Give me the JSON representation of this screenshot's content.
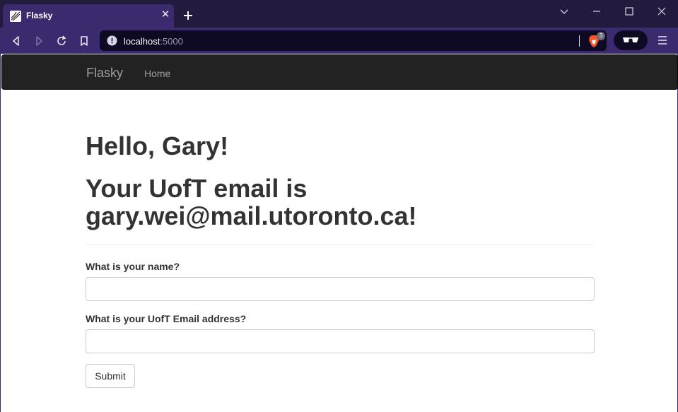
{
  "browser": {
    "tab_title": "Flasky",
    "url_host": "localhost",
    "url_port": ":5000",
    "shields_count": "3"
  },
  "navbar": {
    "brand": "Flasky",
    "home_link": "Home",
    "bg_color": "#222222"
  },
  "main": {
    "greeting": "Hello, Gary!",
    "email_heading": "Your UofT email is gary.wei@mail.utoronto.ca!"
  },
  "form": {
    "name_label": "What is your name?",
    "name_value": "",
    "email_label": "What is your UofT Email address?",
    "email_value": "",
    "submit_label": "Submit"
  },
  "icons": {
    "tab_favicon": "flask-icon",
    "tab_close": "close-icon",
    "new_tab": "plus-icon",
    "back": "back-arrow-icon",
    "forward": "forward-arrow-icon",
    "reload": "reload-icon",
    "bookmark": "bookmark-icon",
    "site_info": "info-icon",
    "shields": "brave-lion-icon",
    "extension": "glasses-icon",
    "menu": "hamburger-icon"
  },
  "colors": {
    "chrome_dark": "#221b3d",
    "chrome_accent": "#3b2a6e",
    "url_bg": "#0e0a24",
    "heading": "#333333"
  }
}
